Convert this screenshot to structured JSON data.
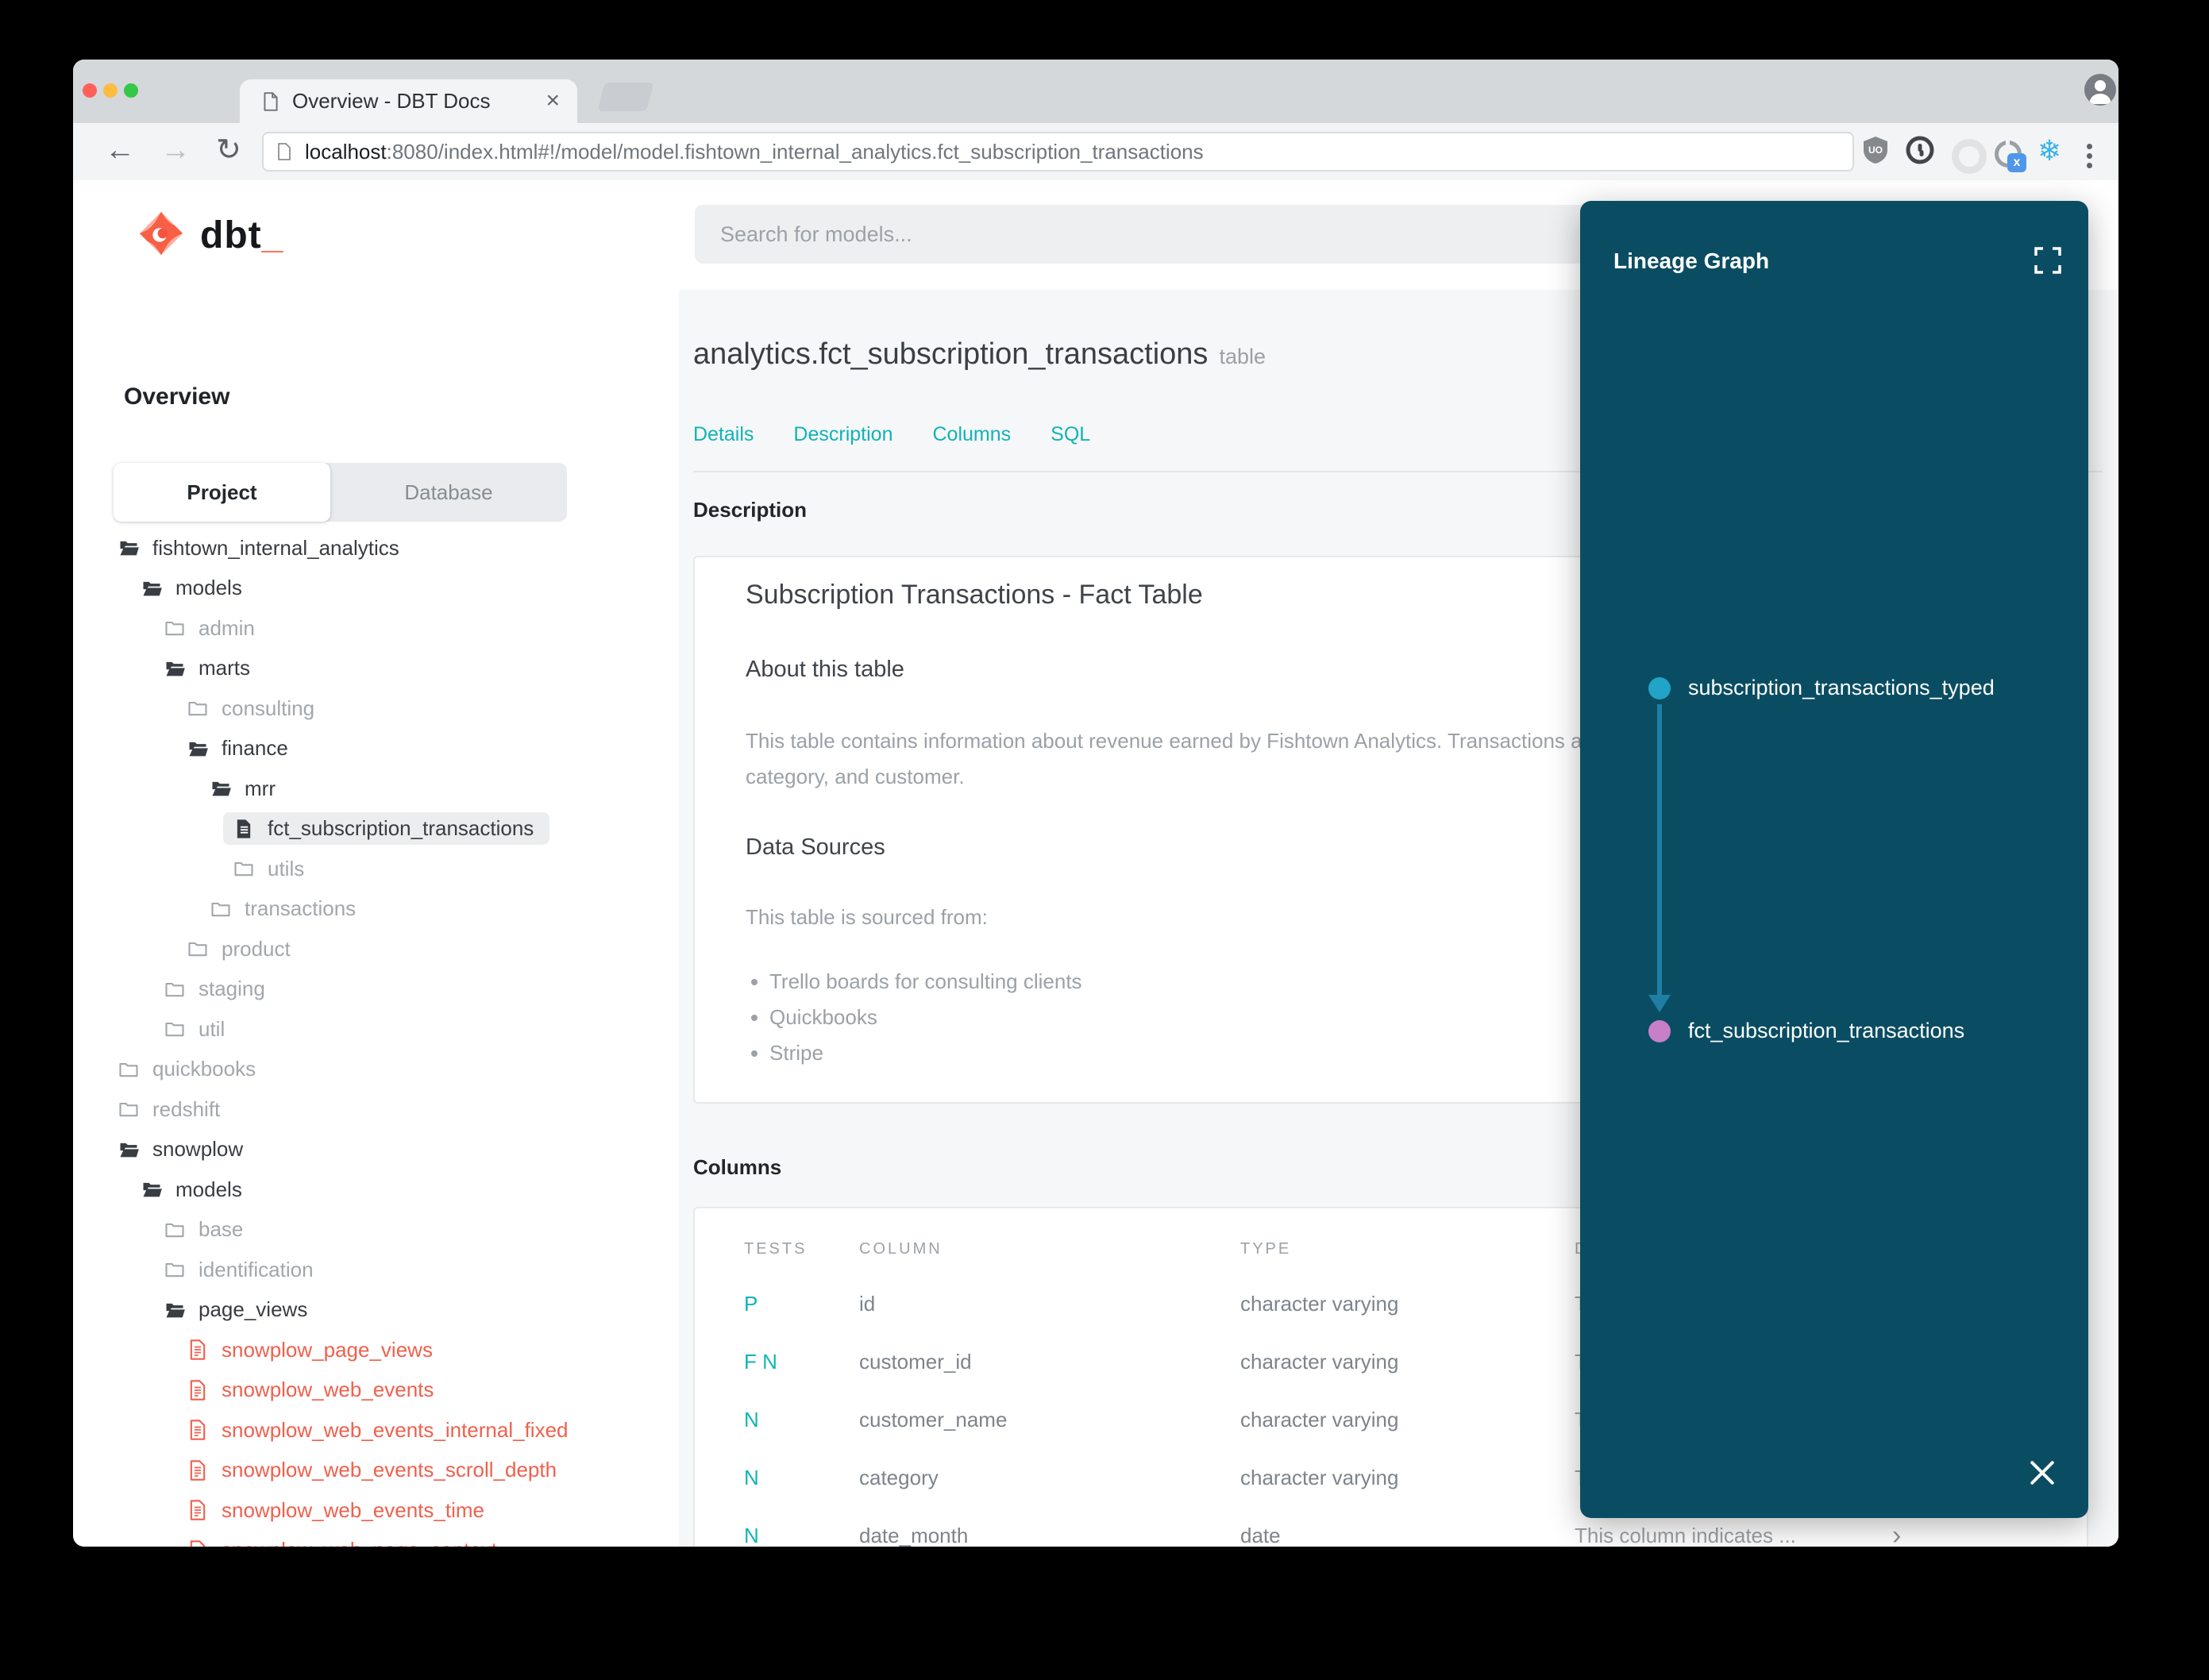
{
  "browser": {
    "tab_title": "Overview - DBT Docs",
    "url_host": "localhost",
    "url_rest": ":8080/index.html#!/model/model.fishtown_internal_analytics.fct_subscription_transactions"
  },
  "header": {
    "logo_text": "dbt",
    "logo_cursor": "_",
    "search_placeholder": "Search for models..."
  },
  "sidebar": {
    "title": "Overview",
    "tabs": [
      {
        "label": "Project",
        "active": true
      },
      {
        "label": "Database",
        "active": false
      }
    ],
    "tree": [
      {
        "label": "fishtown_internal_analytics",
        "level": 0,
        "icon": "folder-open",
        "variant": "dark"
      },
      {
        "label": "models",
        "level": 1,
        "icon": "folder-open",
        "variant": "dark"
      },
      {
        "label": "admin",
        "level": 2,
        "icon": "folder",
        "variant": "muted"
      },
      {
        "label": "marts",
        "level": 2,
        "icon": "folder-open",
        "variant": "dark"
      },
      {
        "label": "consulting",
        "level": 3,
        "icon": "folder",
        "variant": "muted"
      },
      {
        "label": "finance",
        "level": 3,
        "icon": "folder-open",
        "variant": "dark"
      },
      {
        "label": "mrr",
        "level": 4,
        "icon": "folder-open",
        "variant": "dark"
      },
      {
        "label": "fct_subscription_transactions",
        "level": 5,
        "icon": "file-filled",
        "variant": "dark",
        "selected": true
      },
      {
        "label": "utils",
        "level": 5,
        "icon": "folder",
        "variant": "muted"
      },
      {
        "label": "transactions",
        "level": 4,
        "icon": "folder",
        "variant": "muted"
      },
      {
        "label": "product",
        "level": 3,
        "icon": "folder",
        "variant": "muted"
      },
      {
        "label": "staging",
        "level": 2,
        "icon": "folder",
        "variant": "muted"
      },
      {
        "label": "util",
        "level": 2,
        "icon": "folder",
        "variant": "muted"
      },
      {
        "label": "quickbooks",
        "level": 0,
        "icon": "folder",
        "variant": "muted"
      },
      {
        "label": "redshift",
        "level": 0,
        "icon": "folder",
        "variant": "muted"
      },
      {
        "label": "snowplow",
        "level": 0,
        "icon": "folder-open",
        "variant": "dark"
      },
      {
        "label": "models",
        "level": 1,
        "icon": "folder-open",
        "variant": "dark"
      },
      {
        "label": "base",
        "level": 2,
        "icon": "folder",
        "variant": "muted"
      },
      {
        "label": "identification",
        "level": 2,
        "icon": "folder",
        "variant": "muted"
      },
      {
        "label": "page_views",
        "level": 2,
        "icon": "folder-open",
        "variant": "dark"
      },
      {
        "label": "snowplow_page_views",
        "level": 3,
        "icon": "file-outline",
        "variant": "error"
      },
      {
        "label": "snowplow_web_events",
        "level": 3,
        "icon": "file-outline",
        "variant": "error"
      },
      {
        "label": "snowplow_web_events_internal_fixed",
        "level": 3,
        "icon": "file-outline",
        "variant": "error"
      },
      {
        "label": "snowplow_web_events_scroll_depth",
        "level": 3,
        "icon": "file-outline",
        "variant": "error"
      },
      {
        "label": "snowplow_web_events_time",
        "level": 3,
        "icon": "file-outline",
        "variant": "error"
      },
      {
        "label": "snowplow_web_page_context",
        "level": 3,
        "icon": "file-outline",
        "variant": "error"
      }
    ]
  },
  "main": {
    "title": "analytics.fct_subscription_transactions",
    "title_badge": "table",
    "nav": [
      "Details",
      "Description",
      "Columns",
      "SQL"
    ],
    "section_description": "Description",
    "section_columns": "Columns",
    "doc": {
      "h1": "Subscription Transactions - Fact Table",
      "about_heading": "About this table",
      "about_line1": "This table contains information about revenue earned by Fishtown Analytics. Transactions are grouped by month,",
      "about_line2": "category, and customer.",
      "sources_heading": "Data Sources",
      "sources_intro": "This table is sourced from:",
      "sources": [
        "Trello boards for consulting clients",
        "Quickbooks",
        "Stripe"
      ]
    },
    "table": {
      "headers": [
        "TESTS",
        "COLUMN",
        "TYPE",
        "DESCRIPTION"
      ],
      "rows": [
        {
          "tests": "P",
          "column": "id",
          "type": "character varying",
          "description": "This column indicates ..."
        },
        {
          "tests": "F N",
          "column": "customer_id",
          "type": "character varying",
          "description": "This column indicates ..."
        },
        {
          "tests": "N",
          "column": "customer_name",
          "type": "character varying",
          "description": "This column indicates ..."
        },
        {
          "tests": "N",
          "column": "category",
          "type": "character varying",
          "description": "This column indicates ..."
        },
        {
          "tests": "N",
          "column": "date_month",
          "type": "date",
          "description": "This column indicates ..."
        }
      ]
    }
  },
  "lineage": {
    "title": "Lineage Graph",
    "edge_color": "#1e7fa3",
    "nodes": [
      {
        "label": "subscription_transactions_typed",
        "color": "#22a3c8"
      },
      {
        "label": "fct_subscription_transactions",
        "color": "#c77fc7"
      }
    ]
  },
  "colors": {
    "accent_teal": "#11b3b6",
    "accent_red": "#f0604d",
    "panel_bg": "#0a4d63",
    "logo_orange": "#ff6a4d"
  }
}
